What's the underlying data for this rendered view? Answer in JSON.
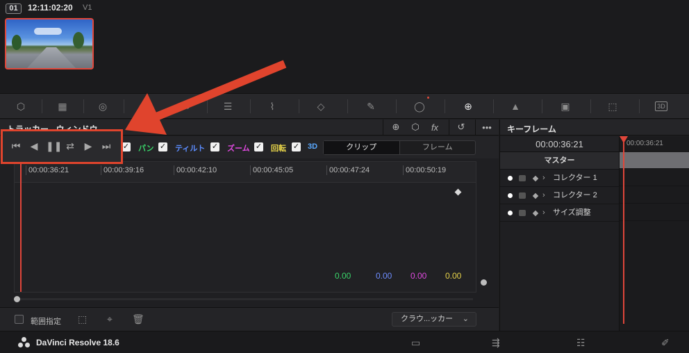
{
  "clip": {
    "number": "01",
    "timecode": "12:11:02:20",
    "track": "V1"
  },
  "tools": [
    {
      "name": "3d-cube-icon"
    },
    {
      "name": "grid-icon"
    },
    {
      "name": "circle-icon"
    },
    {
      "name": "power-window-icon"
    },
    {
      "name": "link-icon"
    },
    {
      "name": "blur-icon"
    },
    {
      "name": "curve-icon"
    },
    {
      "name": "mesh-icon"
    },
    {
      "name": "eyedropper-icon"
    },
    {
      "name": "qualifier-icon"
    },
    {
      "name": "tracker-icon"
    },
    {
      "name": "droplets-icon"
    },
    {
      "name": "mask-icon"
    },
    {
      "name": "resize-icon"
    },
    {
      "name": "3d-icon",
      "label": "3D"
    }
  ],
  "tracker": {
    "title": "トラッカー - ウィンドウ",
    "checks": [
      {
        "label": "パン",
        "color": "#3ad56a"
      },
      {
        "label": "ティルト",
        "color": "#5c8dff"
      },
      {
        "label": "ズーム",
        "color": "#e04ae0"
      },
      {
        "label": "回転",
        "color": "#e8d44a"
      },
      {
        "label": "3D",
        "color": "#5aa9ff"
      }
    ],
    "mode_clip": "クリップ",
    "mode_frame": "フレーム",
    "ruler": [
      "00:00:36:21",
      "00:00:39:16",
      "00:00:42:10",
      "00:00:45:05",
      "00:00:47:24",
      "00:00:50:19"
    ],
    "values": [
      {
        "v": "0.00",
        "color": "#3ad56a"
      },
      {
        "v": "0.00",
        "color": "#6e8dff"
      },
      {
        "v": "0.00",
        "color": "#e04ae0"
      },
      {
        "v": "0.00",
        "color": "#e8d44a"
      }
    ],
    "range_label": "範囲指定",
    "dropdown": "クラウ...ッカー"
  },
  "keyframes": {
    "title": "キーフレーム",
    "timecode": "00:00:36:21",
    "ruler_tc": "00:00:36:21",
    "master": "マスター",
    "rows": [
      "コレクター 1",
      "コレクター 2",
      "サイズ調整"
    ]
  },
  "app": {
    "name": "DaVinci Resolve 18.6"
  },
  "annotation": {
    "color": "#e0442d"
  }
}
